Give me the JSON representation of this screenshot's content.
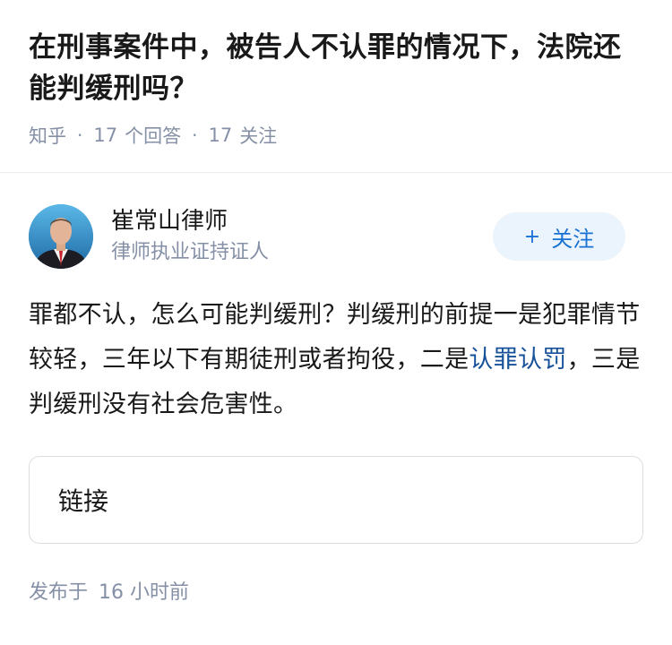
{
  "question": {
    "title": "在刑事案件中，被告人不认罪的情况下，法院还能判缓刑吗？",
    "source": "知乎",
    "answer_count": "17",
    "answer_label": "个回答",
    "follower_count": "17",
    "follower_label": "关注",
    "separator": "·"
  },
  "author": {
    "name": "崔常山律师",
    "badge": "律师执业证持证人",
    "avatar_icon": "lawyer-portrait",
    "follow_plus": "+",
    "follow_label": "关注"
  },
  "answer": {
    "text_before_link": "罪都不认，怎么可能判缓刑？判缓刑的前提一是犯罪情节较轻，三年以下有期徒刑或者拘役，二是",
    "link_text": "认罪认罚",
    "text_after_link": "，三是判缓刑没有社会危害性。"
  },
  "link_card": {
    "label": "链接"
  },
  "footer": {
    "published_label": "发布于",
    "published_time": "16 小时前"
  },
  "colors": {
    "primary_text": "#191919",
    "secondary_text": "#8590a6",
    "link_blue": "#175199",
    "button_blue": "#1772d4",
    "button_bg": "#ebf3fc"
  }
}
